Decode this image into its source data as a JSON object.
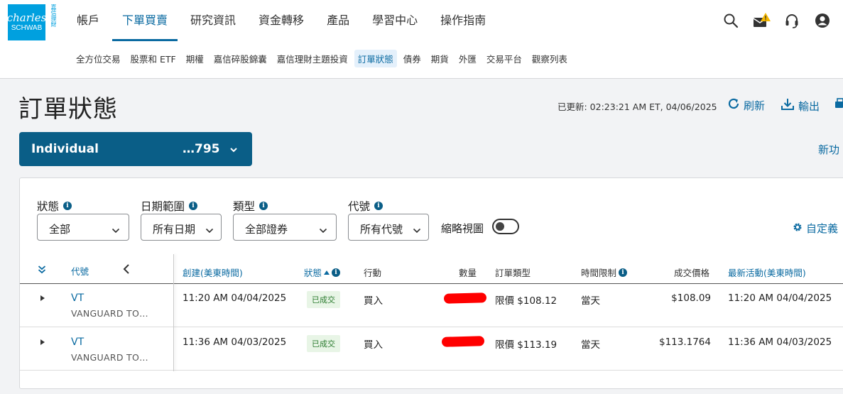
{
  "brand": {
    "logo_line1": "charles",
    "logo_line2": "SCHWAB",
    "logo_cn": "嘉信理財"
  },
  "main_nav": [
    {
      "label": "帳戶",
      "active": false
    },
    {
      "label": "下單買賣",
      "active": true
    },
    {
      "label": "研究資訊",
      "active": false
    },
    {
      "label": "資金轉移",
      "active": false
    },
    {
      "label": "產品",
      "active": false
    },
    {
      "label": "學習中心",
      "active": false
    },
    {
      "label": "操作指南",
      "active": false
    }
  ],
  "header_icons": [
    "search-icon",
    "mail-alert-icon",
    "headset-icon",
    "user-icon"
  ],
  "sub_nav": [
    {
      "label": "全方位交易",
      "active": false
    },
    {
      "label": "股票和 ETF",
      "active": false
    },
    {
      "label": "期權",
      "active": false
    },
    {
      "label": "嘉信碎股錦囊",
      "active": false
    },
    {
      "label": "嘉信理財主題投資",
      "active": false
    },
    {
      "label": "訂單狀態",
      "active": true
    },
    {
      "label": "債券",
      "active": false
    },
    {
      "label": "期貨",
      "active": false
    },
    {
      "label": "外匯",
      "active": false
    },
    {
      "label": "交易平台",
      "active": false
    },
    {
      "label": "觀察列表",
      "active": false
    }
  ],
  "page": {
    "title": "訂單狀態",
    "updated": "已更新: 02:23:21 AM ET, 04/06/2025",
    "refresh_label": "刷新",
    "export_label": "輸出"
  },
  "account": {
    "name": "Individual",
    "number": "…795"
  },
  "new_feature": "新功",
  "filters": {
    "status": {
      "label": "狀態",
      "value": "全部"
    },
    "date_range": {
      "label": "日期範圍",
      "value": "所有日期"
    },
    "type": {
      "label": "類型",
      "value": "全部證券"
    },
    "symbol": {
      "label": "代號",
      "value": "所有代號"
    },
    "compact_view": {
      "label": "縮略視圖",
      "on": false
    },
    "customize_label": "自定義"
  },
  "table": {
    "headers": {
      "symbol": "代號",
      "created": "創建(美東時間)",
      "status": "狀態",
      "action": "行動",
      "quantity": "數量",
      "order_type": "訂單類型",
      "time_limit": "時間限制",
      "fill_price": "成交價格",
      "last_activity": "最新活動(美東時間)"
    },
    "rows": [
      {
        "symbol": "VT",
        "description": "VANGUARD TO…",
        "created": "11:20 AM 04/04/2025",
        "status": "已成交",
        "action": "買入",
        "quantity": "",
        "order_type": "限價 $108.12",
        "time_limit": "當天",
        "fill_price": "$108.09",
        "last_activity": "11:20 AM 04/04/2025"
      },
      {
        "symbol": "VT",
        "description": "VANGUARD TO…",
        "created": "11:36 AM 04/03/2025",
        "status": "已成交",
        "action": "買入",
        "quantity": "",
        "order_type": "限價 $113.19",
        "time_limit": "當天",
        "fill_price": "$113.1764",
        "last_activity": "11:36 AM 04/03/2025"
      }
    ]
  },
  "colors": {
    "brand_blue": "#00a0df",
    "link_blue": "#0a6aa1",
    "account_bar": "#0a5e87",
    "filled_badge_bg": "#e8f5e6",
    "filled_badge_text": "#2e7d32",
    "redaction": "#ff0000"
  }
}
